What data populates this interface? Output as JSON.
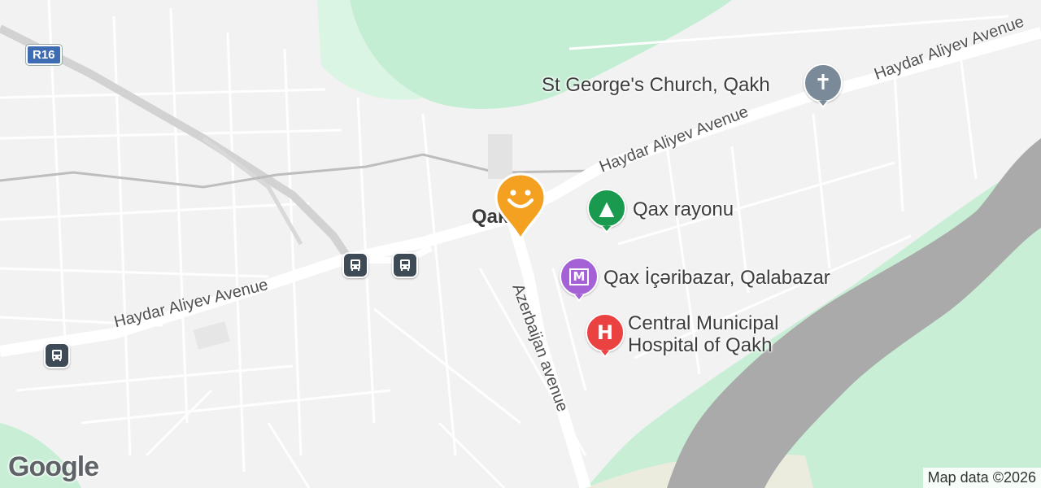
{
  "map": {
    "city_label": "Qakh",
    "road_shield": "R16",
    "roads": {
      "haydar_1": "Haydar Aliyev Avenue",
      "haydar_2": "Haydar Aliyev Avenue",
      "haydar_3": "Haydar Aliyev Avenue",
      "azerbaijan": "Azerbaijan avenue"
    },
    "pois": {
      "church": "St George's Church, Qakh",
      "park": "Qax rayonu",
      "museum": "Qax İçəribazar, Qalabazar",
      "hospital_line1": "Central Municipal",
      "hospital_line2": "Hospital of Qakh"
    },
    "icons": {
      "church": "church-cross-icon",
      "park": "tree-icon",
      "museum": "museum-icon",
      "hospital": "hospital-icon",
      "bus": "bus-stop-icon",
      "marker": "smiley-location-marker-icon"
    },
    "colors": {
      "land": "#f2f2f2",
      "park": "#c8efd6",
      "river": "#aaaaaa",
      "church_pin": "#7a8a98",
      "park_pin": "#1a9a4f",
      "museum_pin": "#a462d6",
      "hospital_pin": "#ea4141",
      "marker": "#f4a020"
    }
  },
  "footer": {
    "logo": "Google",
    "attribution": "Map data ©2026"
  }
}
